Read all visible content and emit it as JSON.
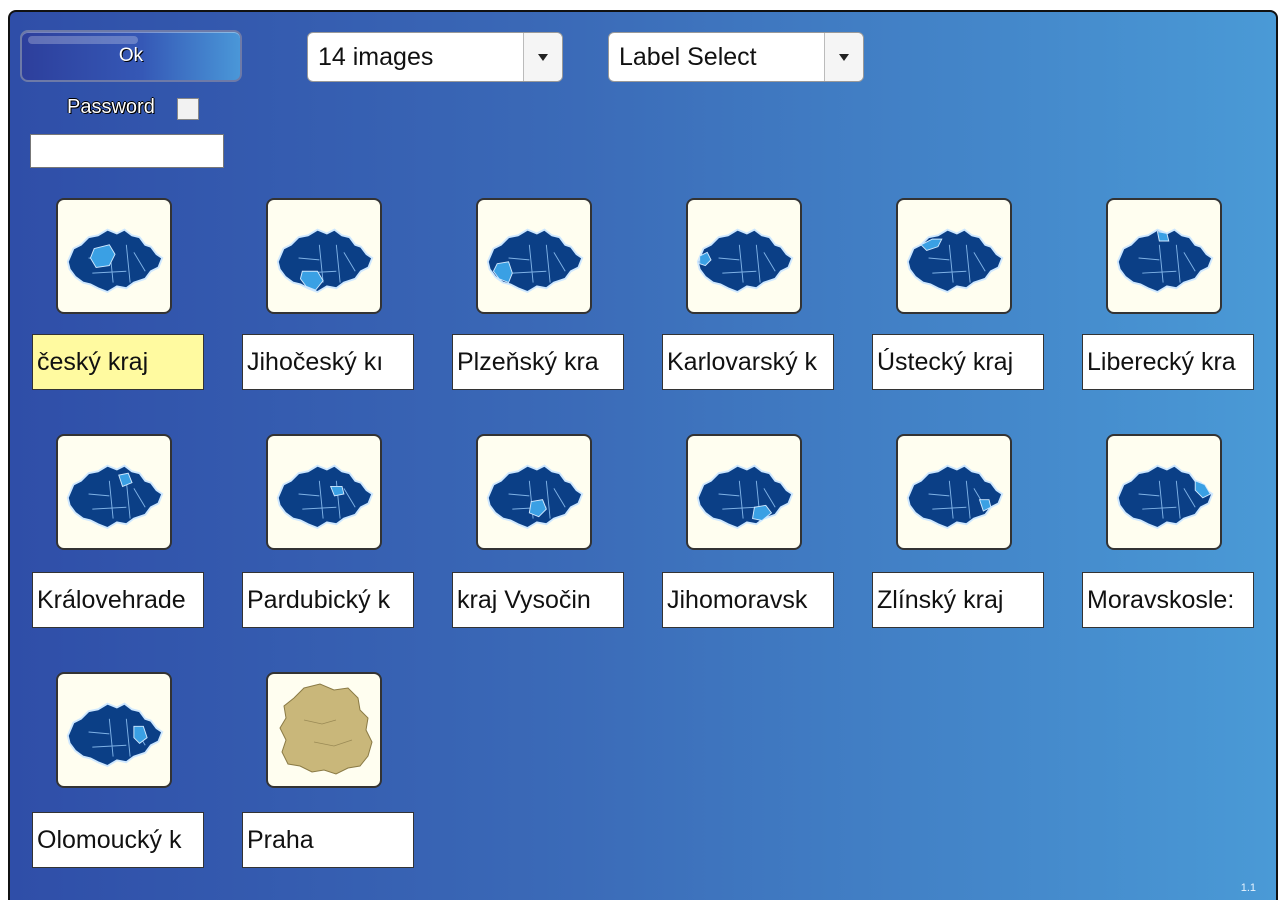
{
  "toolbar": {
    "ok_label": "Ok",
    "image_count_select": "14 images",
    "label_select": "Label Select",
    "password_label": "Password",
    "password_value": ""
  },
  "tiles": [
    {
      "label": "Středočeský kraj",
      "visible_text": "český kraj",
      "selected": true,
      "map": "czech-region",
      "highlight": "region-1"
    },
    {
      "label": "Jihočeský kraj",
      "visible_text": "Jihočeský kı",
      "selected": false,
      "map": "czech-region",
      "highlight": "region-2"
    },
    {
      "label": "Plzeňský kraj",
      "visible_text": "Plzeňský kra",
      "selected": false,
      "map": "czech-region",
      "highlight": "region-3"
    },
    {
      "label": "Karlovarský kraj",
      "visible_text": "Karlovarský k",
      "selected": false,
      "map": "czech-region",
      "highlight": "region-4"
    },
    {
      "label": "Ústecký kraj",
      "visible_text": "Ústecký kraj",
      "selected": false,
      "map": "czech-region",
      "highlight": "region-5"
    },
    {
      "label": "Liberecký kraj",
      "visible_text": "Liberecký kra",
      "selected": false,
      "map": "czech-region",
      "highlight": "region-6"
    },
    {
      "label": "Královehradecký kraj",
      "visible_text": "Královehrade",
      "selected": false,
      "map": "czech-region",
      "highlight": "region-7"
    },
    {
      "label": "Pardubický kraj",
      "visible_text": "Pardubický k",
      "selected": false,
      "map": "czech-region",
      "highlight": "region-8"
    },
    {
      "label": "kraj Vysočina",
      "visible_text": "kraj Vysočin",
      "selected": false,
      "map": "czech-region",
      "highlight": "region-9"
    },
    {
      "label": "Jihomoravský kraj",
      "visible_text": "Jihomoravsk",
      "selected": false,
      "map": "czech-region",
      "highlight": "region-10"
    },
    {
      "label": "Zlínský kraj",
      "visible_text": "Zlínský kraj",
      "selected": false,
      "map": "czech-region",
      "highlight": "region-11"
    },
    {
      "label": "Moravskoslezský kraj",
      "visible_text": "Moravskosle:",
      "selected": false,
      "map": "czech-region",
      "highlight": "region-12"
    },
    {
      "label": "Olomoucký kraj",
      "visible_text": "Olomoucký k",
      "selected": false,
      "map": "czech-region",
      "highlight": "region-13"
    },
    {
      "label": "Praha",
      "visible_text": "Praha",
      "selected": false,
      "map": "prague-map",
      "highlight": ""
    }
  ],
  "version": "1.1",
  "colors": {
    "map_dark": "#0b3f86",
    "map_highlight": "#3aa0e4",
    "prague_fill": "#c9b77a"
  }
}
